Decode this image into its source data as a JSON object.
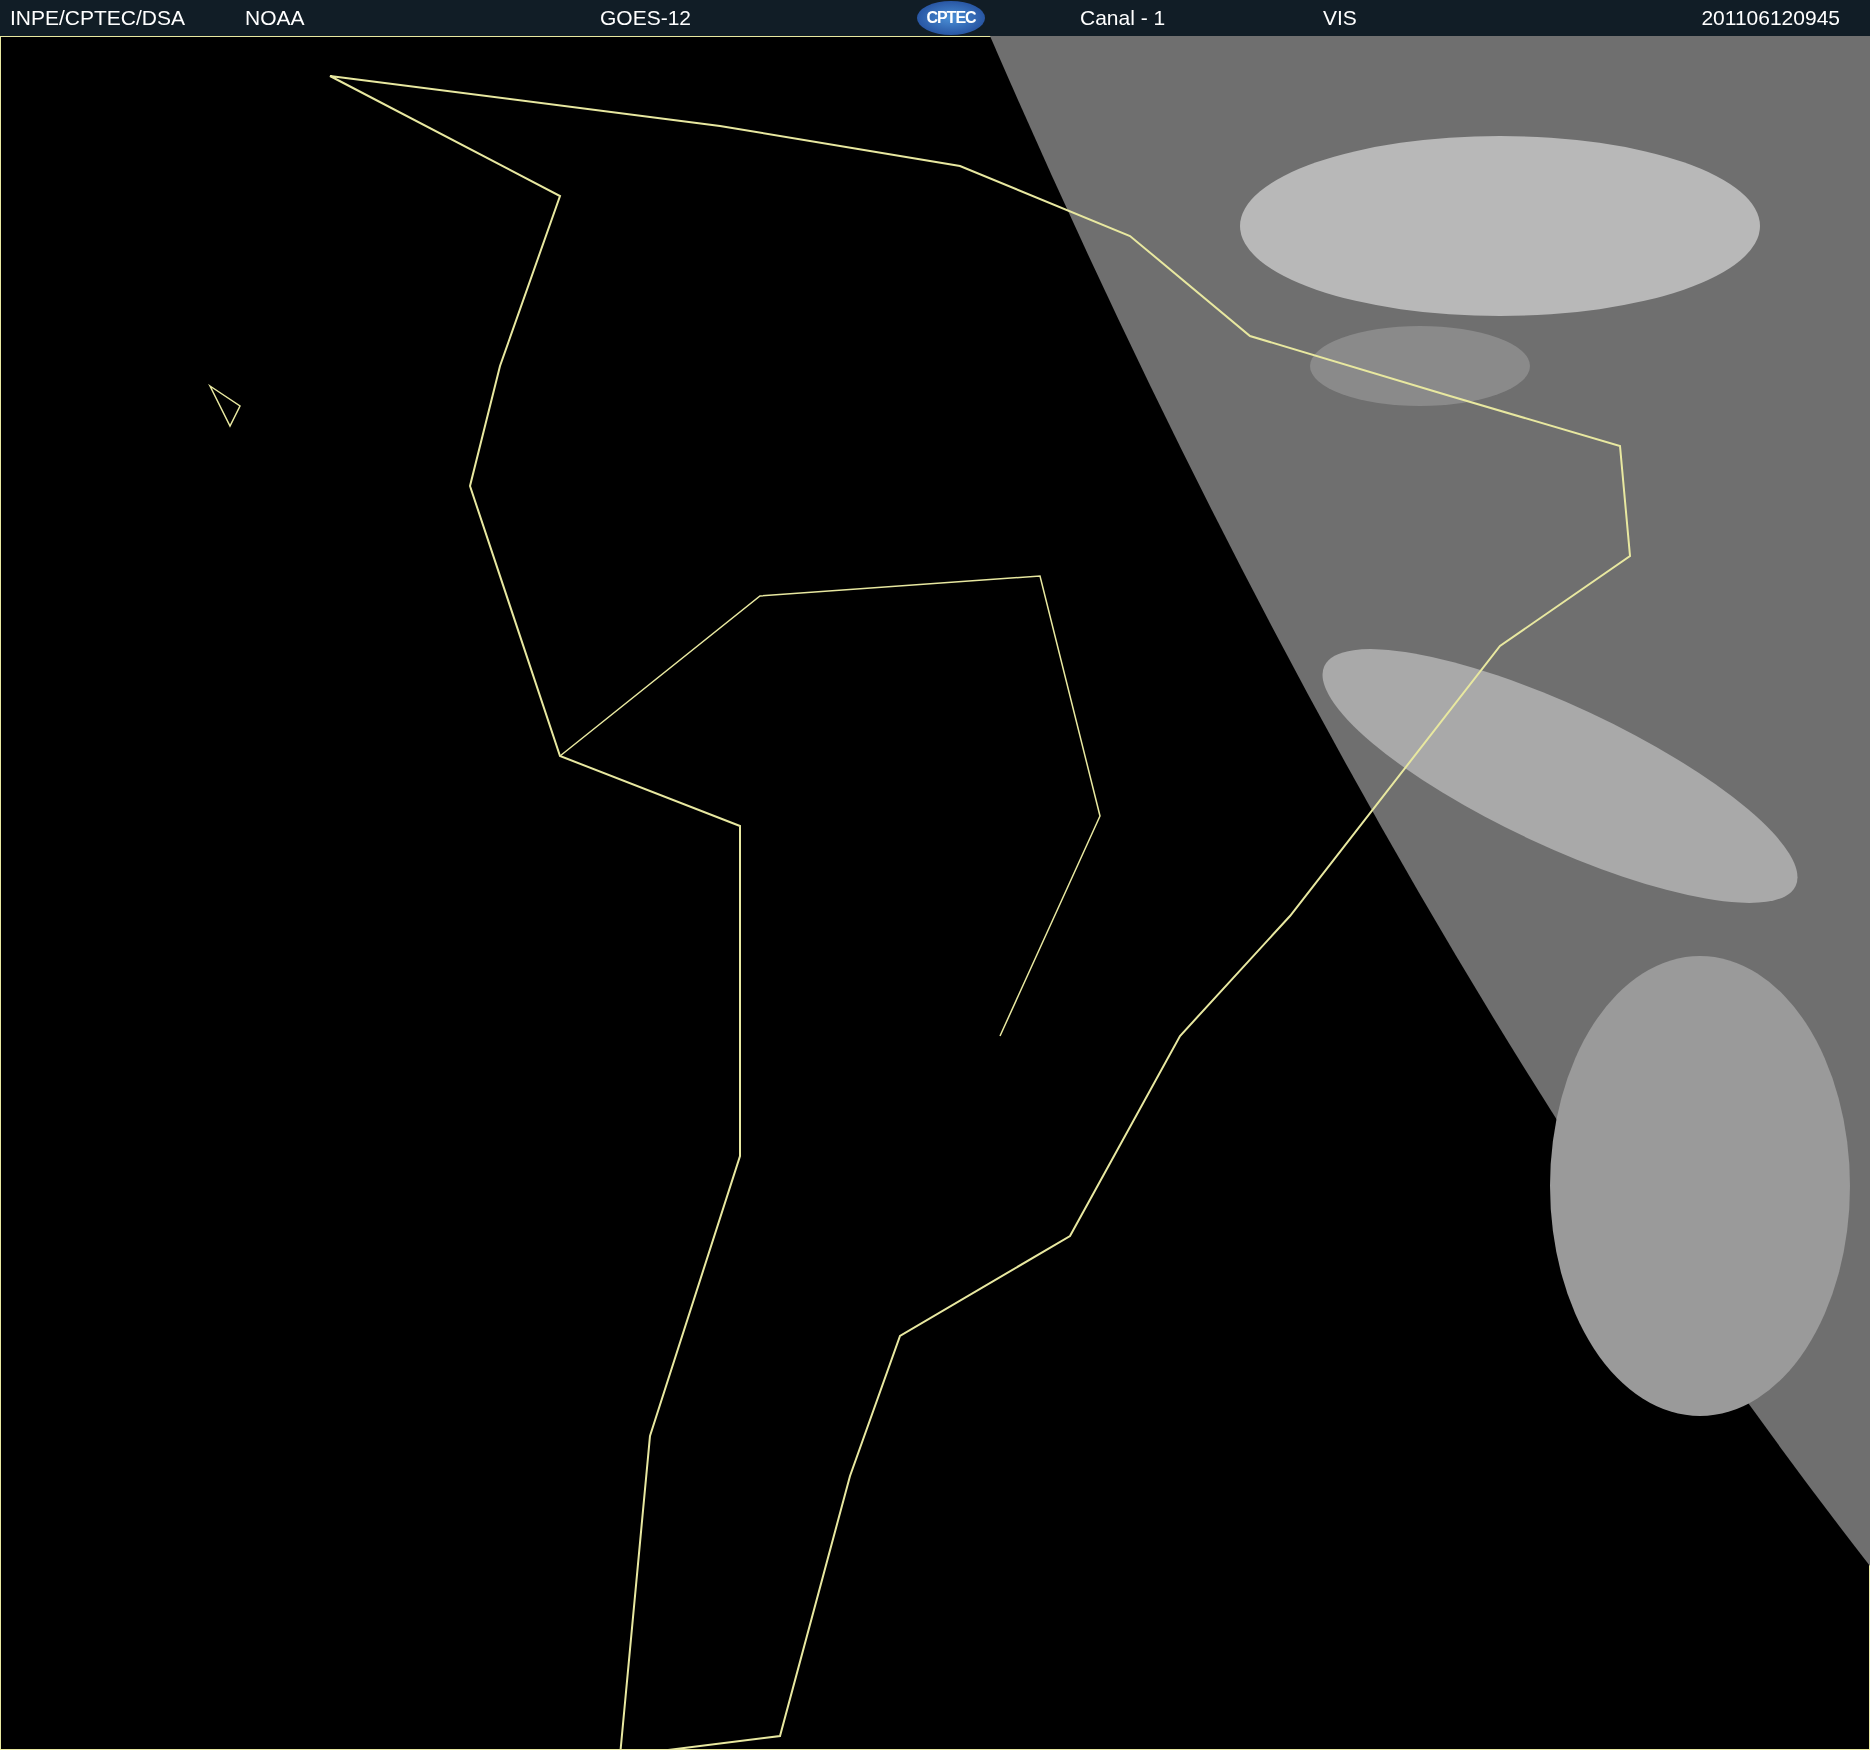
{
  "header": {
    "items": [
      {
        "kind": "text",
        "text": "INPE/CPTEC/DSA"
      },
      {
        "kind": "text",
        "text": "NOAA"
      },
      {
        "kind": "text",
        "text": "GOES-12"
      },
      {
        "kind": "logo",
        "text": "CPTEC"
      },
      {
        "kind": "text",
        "text": "Canal - 1"
      },
      {
        "kind": "text",
        "text": "VIS"
      },
      {
        "kind": "text",
        "text": "201106120945"
      }
    ]
  }
}
